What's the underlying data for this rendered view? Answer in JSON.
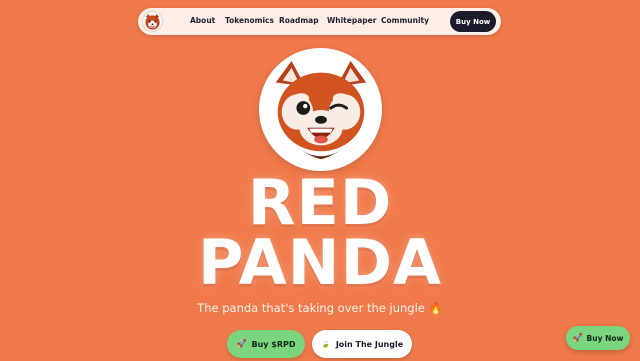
{
  "nav": {
    "logo_icon": "red-panda-logo-icon",
    "links": [
      "About",
      "Tokenomics",
      "Roadmap",
      "Whitepaper",
      "Community"
    ],
    "buy_label": "Buy Now"
  },
  "hero": {
    "avatar_icon": "red-panda-mascot-icon",
    "title_line1": "RED",
    "title_line2": "PANDA",
    "tagline": "The panda that's taking over the jungle 🔥",
    "buy_button": {
      "icon": "rocket-icon",
      "label": "Buy $RPD"
    },
    "join_button": {
      "icon": "leaf-icon",
      "label": "Join The Jungle"
    }
  },
  "floating": {
    "icon": "rocket-icon",
    "label": "Buy Now"
  },
  "colors": {
    "background": "#f07a4b",
    "nav_bg": "#fdeee7",
    "dark": "#1b1b2c",
    "green": "#7bd57f",
    "white": "#ffffff"
  }
}
